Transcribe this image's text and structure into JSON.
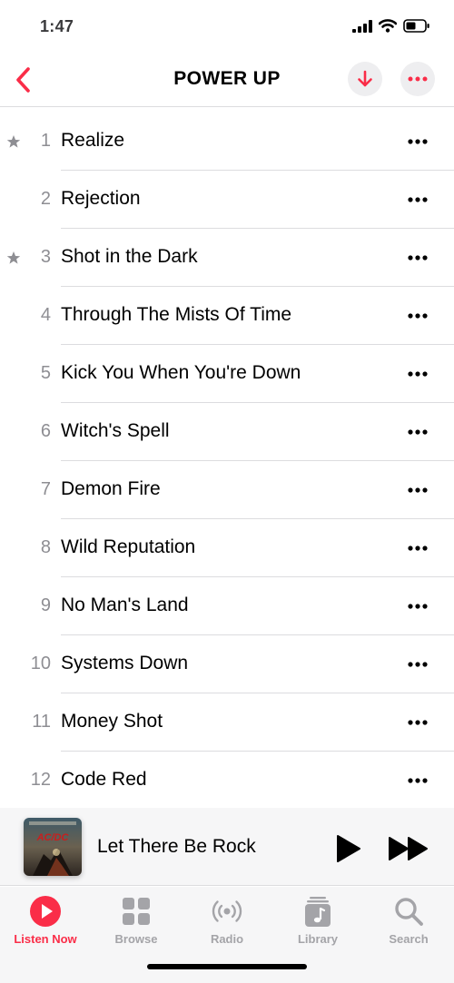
{
  "status_bar": {
    "time": "1:47"
  },
  "nav": {
    "title": "POWER UP"
  },
  "tracks": [
    {
      "number": "1",
      "title": "Realize",
      "starred": true
    },
    {
      "number": "2",
      "title": "Rejection",
      "starred": false
    },
    {
      "number": "3",
      "title": "Shot in the Dark",
      "starred": true
    },
    {
      "number": "4",
      "title": "Through The Mists Of Time",
      "starred": false
    },
    {
      "number": "5",
      "title": "Kick You When You're Down",
      "starred": false
    },
    {
      "number": "6",
      "title": "Witch's Spell",
      "starred": false
    },
    {
      "number": "7",
      "title": "Demon Fire",
      "starred": false
    },
    {
      "number": "8",
      "title": "Wild Reputation",
      "starred": false
    },
    {
      "number": "9",
      "title": "No Man's Land",
      "starred": false
    },
    {
      "number": "10",
      "title": "Systems Down",
      "starred": false
    },
    {
      "number": "11",
      "title": "Money Shot",
      "starred": false
    },
    {
      "number": "12",
      "title": "Code Red",
      "starred": false
    }
  ],
  "mini_player": {
    "title": "Let There Be Rock",
    "artwork_logo": "AC/DC"
  },
  "tabs": [
    {
      "label": "Listen Now",
      "icon": "play-circle-icon",
      "active": true
    },
    {
      "label": "Browse",
      "icon": "grid-icon",
      "active": false
    },
    {
      "label": "Radio",
      "icon": "broadcast-icon",
      "active": false
    },
    {
      "label": "Library",
      "icon": "music-note-stack-icon",
      "active": false
    },
    {
      "label": "Search",
      "icon": "search-icon",
      "active": false
    }
  ],
  "colors": {
    "accent": "#fa2d48",
    "inactive": "#a4a4a8",
    "secondary_text": "#8e8e93"
  }
}
